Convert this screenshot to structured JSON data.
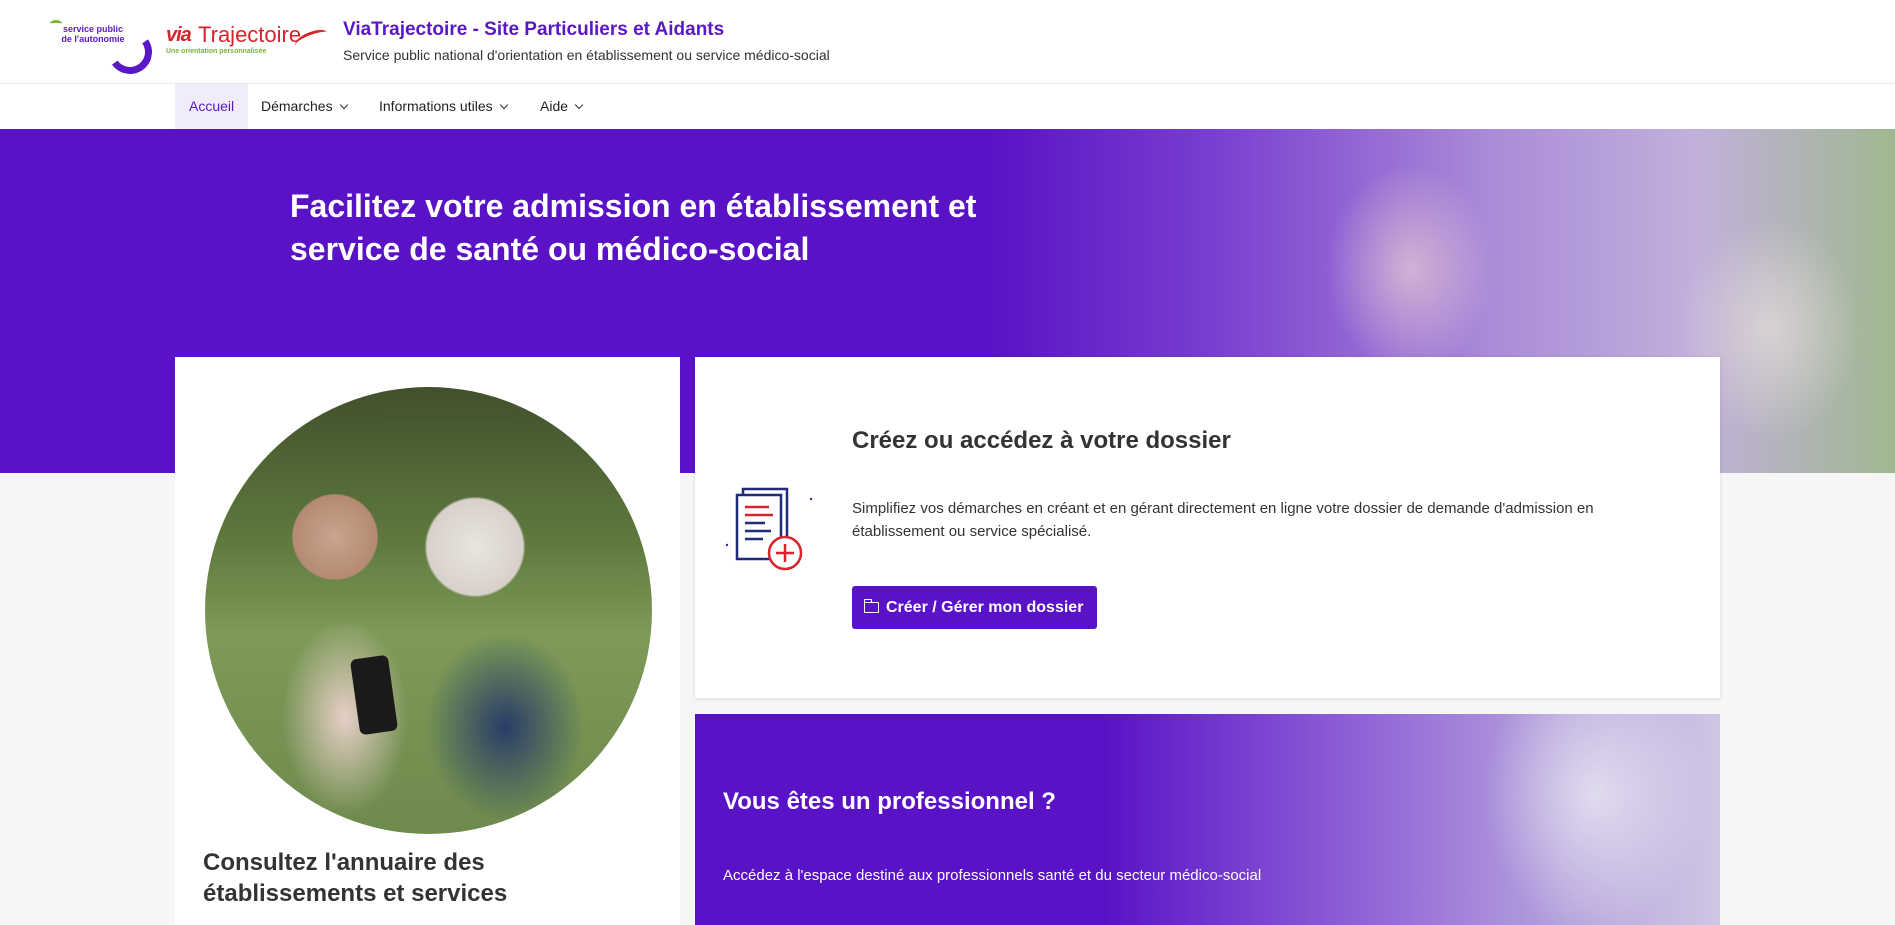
{
  "header": {
    "logo_spa_text": "service public de l'autonomie",
    "logo_via": "via",
    "logo_trajectoire": "Trajectoire",
    "logo_tagline": "Une orientation personnalisée",
    "title": "ViaTrajectoire - Site Particuliers et Aidants",
    "subtitle": "Service public national d'orientation en établissement ou service médico-social"
  },
  "nav": {
    "items": [
      {
        "label": "Accueil",
        "active": true
      },
      {
        "label": "Démarches",
        "dropdown": true
      },
      {
        "label": "Informations utiles",
        "dropdown": true
      },
      {
        "label": "Aide",
        "dropdown": true
      }
    ]
  },
  "hero": {
    "title": "Facilitez votre admission en établissement et service de santé ou médico-social"
  },
  "annuaire": {
    "title": "Consultez l'annuaire des établissements et services"
  },
  "dossier": {
    "title": "Créez ou accédez à votre dossier",
    "text": "Simplifiez vos démarches en créant et en gérant directement en ligne votre dossier de demande d'admission en établissement ou service spécialisé.",
    "button_label": "Créer / Gérer mon dossier",
    "icon": "document-add-icon",
    "button_icon": "folder-icon"
  },
  "pro": {
    "title": "Vous êtes un professionnel ?",
    "text": "Accédez à l'espace destiné aux professionnels santé et du secteur médico-social"
  },
  "colors": {
    "brand_purple": "#5a12c6",
    "brand_red": "#d8232a",
    "brand_green": "#79b537"
  }
}
